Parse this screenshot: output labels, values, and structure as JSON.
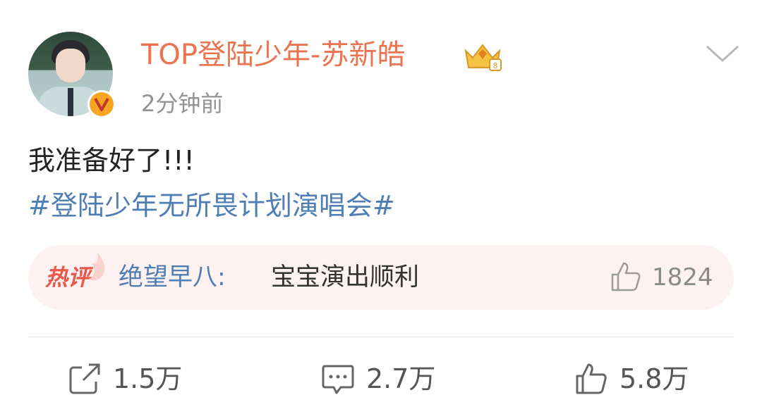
{
  "post": {
    "username": "TOP登陆少年-苏新皓",
    "time": "2分钟前",
    "text": "我准备好了!!!",
    "topic": "#登陆少年无所畏计划演唱会#",
    "verified_icon": "v-badge-icon",
    "crown_icon": "crown-icon"
  },
  "hot_comment": {
    "tag": "热评",
    "user": "绝望早八",
    "separator": ":",
    "text": "宝宝演出顺利",
    "likes": "1824"
  },
  "actions": {
    "repost": "1.5万",
    "comment": "2.7万",
    "like": "5.8万"
  },
  "colors": {
    "username": "#eb7350",
    "link": "#4f7eb5",
    "hot_bg": "#fdf2f1",
    "hot_tag": "#e8574a"
  }
}
